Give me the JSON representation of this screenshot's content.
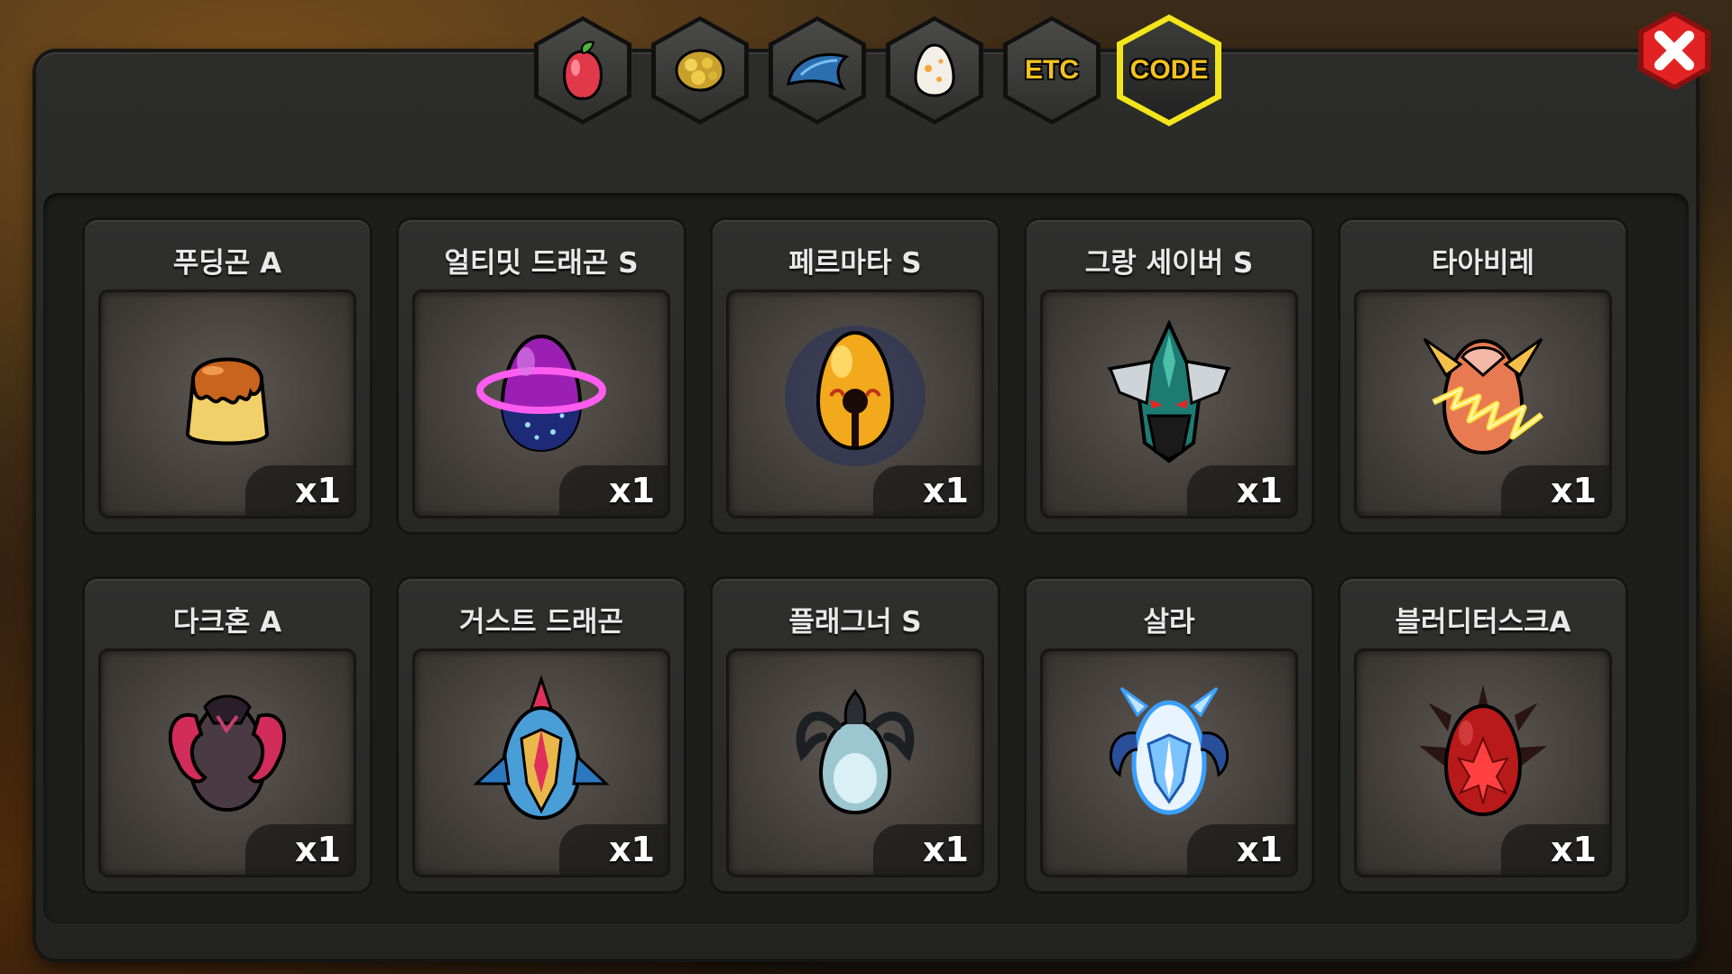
{
  "tabs": [
    {
      "id": "fruit",
      "icon": "red-fruit-icon"
    },
    {
      "id": "ore",
      "icon": "gold-ore-icon"
    },
    {
      "id": "feather",
      "icon": "blue-scale-icon"
    },
    {
      "id": "egg",
      "icon": "egg-icon"
    },
    {
      "id": "etc",
      "label": "ETC"
    },
    {
      "id": "code",
      "label": "CODE",
      "active": true
    }
  ],
  "colors": {
    "accent": "#f3e51c",
    "tab_text": "#f3c21c",
    "close": "#e32323"
  },
  "items": [
    {
      "name": "푸딩곤 A",
      "qty": "x1",
      "icon": "pudding-egg-icon"
    },
    {
      "name": "얼티밋 드래곤 S",
      "qty": "x1",
      "icon": "purple-planet-egg-icon"
    },
    {
      "name": "페르마타 S",
      "qty": "x1",
      "icon": "golden-bell-egg-icon"
    },
    {
      "name": "그랑 세이버 S",
      "qty": "x1",
      "icon": "armored-green-egg-icon"
    },
    {
      "name": "타아비레",
      "qty": "x1",
      "icon": "lightning-egg-icon"
    },
    {
      "name": "다크혼 A",
      "qty": "x1",
      "icon": "dark-horned-egg-icon"
    },
    {
      "name": "거스트 드래곤",
      "qty": "x1",
      "icon": "crested-blue-egg-icon"
    },
    {
      "name": "플래그너 S",
      "qty": "x1",
      "icon": "horned-silver-egg-icon"
    },
    {
      "name": "살라",
      "qty": "x1",
      "icon": "ice-horned-egg-icon"
    },
    {
      "name": "블러디터스크A",
      "qty": "x1",
      "icon": "blood-spiked-egg-icon"
    }
  ]
}
